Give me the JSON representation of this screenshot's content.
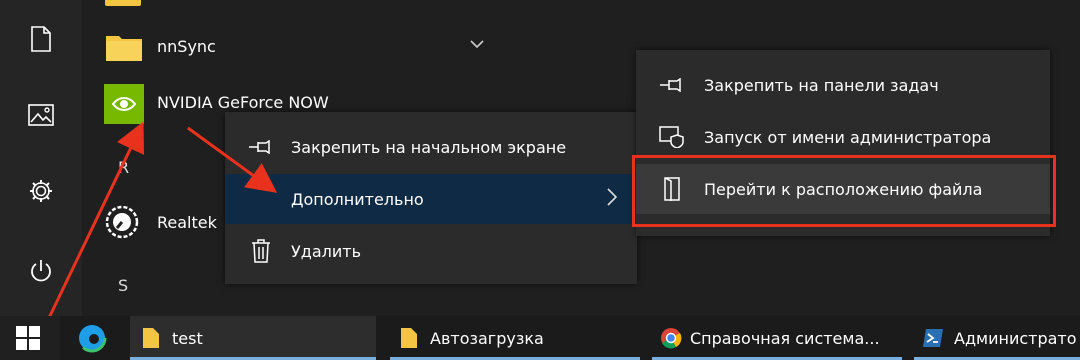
{
  "apps": {
    "nnsync_label": "nnSync",
    "nvidia_label": "NVIDIA GeForce NOW",
    "letter_r": "R",
    "realtek_label": "Realtek",
    "letter_s": "S"
  },
  "context_menu": {
    "pin_start": "Закрепить на начальном экране",
    "more": "Дополнительно",
    "uninstall": "Удалить"
  },
  "submenu": {
    "pin_taskbar": "Закрепить на панели задач",
    "run_as_admin": "Запуск от имени администратора",
    "open_location": "Перейти к расположению файла"
  },
  "taskbar": {
    "items": [
      {
        "label": "test"
      },
      {
        "label": "Автозагрузка"
      },
      {
        "label": "Справочная система..."
      },
      {
        "label": "Администрато"
      }
    ]
  },
  "colors": {
    "accent_highlight": "#0e2a44",
    "annotation_red": "#e8321e",
    "folder_yellow": "#f4c542",
    "nvidia_green": "#76b900"
  }
}
